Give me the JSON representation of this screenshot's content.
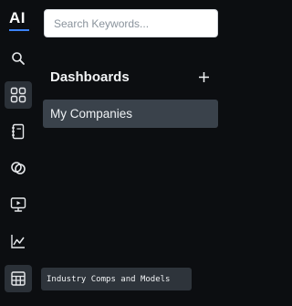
{
  "brand": {
    "logo_text": "AI",
    "accent_color": "#3b82f6"
  },
  "search": {
    "placeholder": "Search Keywords...",
    "value": ""
  },
  "rail": {
    "items": [
      {
        "icon": "search-icon"
      },
      {
        "icon": "dashboard-grid-icon",
        "active": true
      },
      {
        "icon": "notebook-icon"
      },
      {
        "icon": "link-rings-icon"
      },
      {
        "icon": "monitor-play-icon"
      },
      {
        "icon": "line-chart-icon"
      },
      {
        "icon": "table-calculator-icon"
      }
    ]
  },
  "panel": {
    "title": "Dashboards",
    "add_label": "+",
    "items": [
      {
        "label": "My Companies",
        "selected": true
      }
    ]
  },
  "tooltip": {
    "text": "Industry Comps and Models"
  }
}
